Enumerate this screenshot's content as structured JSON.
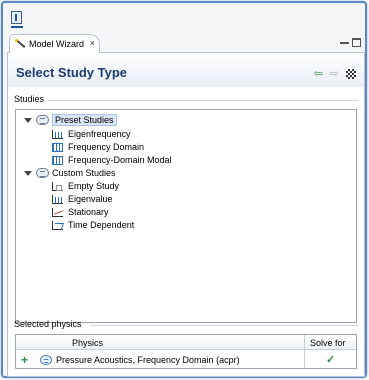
{
  "tab": {
    "label": "Model Wizard",
    "close": "×"
  },
  "header": {
    "title": "Select Study Type"
  },
  "nav": {
    "back": "⇦",
    "forward": "⇨"
  },
  "studies": {
    "group_label": "Studies",
    "categories": [
      {
        "label": "Preset Studies",
        "items": [
          "Eigenfrequency",
          "Frequency Domain",
          "Frequency-Domain Modal"
        ]
      },
      {
        "label": "Custom Studies",
        "items": [
          "Empty Study",
          "Eigenvalue",
          "Stationary",
          "Time Dependent"
        ]
      }
    ]
  },
  "physics": {
    "group_label": "Selected physics",
    "columns": {
      "physics": "Physics",
      "solve_for": "Solve for"
    },
    "rows": [
      {
        "name": "Pressure Acoustics, Frequency Domain (acpr)",
        "add": "+",
        "solve": "✓"
      }
    ]
  },
  "colors": {
    "title": "#1e3c72",
    "selection": "#d9e6f7",
    "check": "#2b8a3e",
    "border": "#5b87c5"
  }
}
